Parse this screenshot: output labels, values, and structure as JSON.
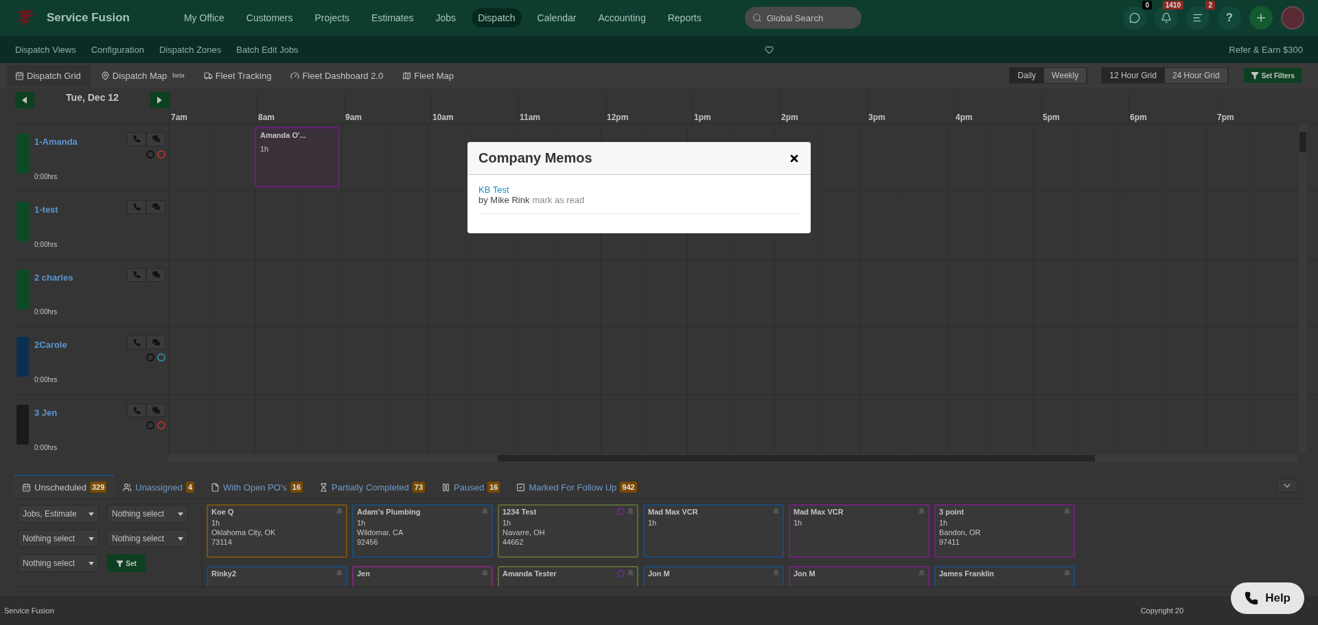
{
  "brand": "Service Fusion",
  "nav": [
    {
      "label": "My Office",
      "selected": false
    },
    {
      "label": "Customers",
      "selected": false
    },
    {
      "label": "Projects",
      "selected": false
    },
    {
      "label": "Estimates",
      "selected": false
    },
    {
      "label": "Jobs",
      "selected": false
    },
    {
      "label": "Dispatch",
      "selected": true
    },
    {
      "label": "Calendar",
      "selected": false
    },
    {
      "label": "Accounting",
      "selected": false
    },
    {
      "label": "Reports",
      "selected": false
    }
  ],
  "search": {
    "placeholder": "Global Search"
  },
  "header_buttons": [
    {
      "kind": "chat",
      "badge": "0",
      "color": "#000000"
    },
    {
      "kind": "bell",
      "badge": "1410",
      "color": "#8a2a22"
    },
    {
      "kind": "list",
      "badge": "2",
      "color": "#8a2a22"
    },
    {
      "kind": "help",
      "label": "?"
    },
    {
      "kind": "add"
    },
    {
      "kind": "avatar"
    }
  ],
  "subnav": [
    "Dispatch Views",
    "Configuration",
    "Dispatch Zones",
    "Batch Edit Jobs"
  ],
  "refer": "Refer & Earn $300",
  "view_tabs": [
    {
      "kind": "grid",
      "label": "Dispatch Grid",
      "selected": true
    },
    {
      "kind": "map",
      "label": "Dispatch Map",
      "sup": "beta",
      "selected": false
    },
    {
      "kind": "truck",
      "label": "Fleet Tracking",
      "selected": false
    },
    {
      "kind": "gauge",
      "label": "Fleet Dashboard 2.0",
      "selected": false
    },
    {
      "kind": "fleetmap",
      "label": "Fleet Map",
      "selected": false
    }
  ],
  "period": [
    {
      "label": "Daily",
      "selected": true
    },
    {
      "label": "Weekly",
      "selected": false
    }
  ],
  "grid_mode": [
    {
      "label": "12 Hour Grid",
      "selected": true
    },
    {
      "label": "24 Hour Grid",
      "selected": false
    }
  ],
  "set_filters": "Set Filters",
  "date": "Tue, Dec 12",
  "hours": [
    "7am",
    "8am",
    "9am",
    "10am",
    "11am",
    "12pm",
    "1pm",
    "2pm",
    "3pm",
    "4pm",
    "5pm",
    "6pm",
    "7pm"
  ],
  "technicians": [
    {
      "name": "1-Amanda",
      "hours": "0:00hrs",
      "color": "#0b4a26",
      "rings": [
        {
          "color": "#111111"
        },
        {
          "color": "#a83232"
        }
      ],
      "jobs": [
        {
          "title": "Amanda O'...",
          "duration": "1h",
          "color": "#6a1f7a"
        }
      ]
    },
    {
      "name": "1-test",
      "hours": "0:00hrs",
      "color": "#0b4a26"
    },
    {
      "name": "2 charles",
      "hours": "0:00hrs",
      "color": "#0b4a26"
    },
    {
      "name": "2Carole",
      "hours": "0:00hrs",
      "color": "#0b2f52",
      "rings": [
        {
          "color": "#111111"
        },
        {
          "color": "#2a8a98"
        }
      ]
    },
    {
      "name": "3 Jen",
      "hours": "0:00hrs",
      "color": "#1a1a1a",
      "rings": [
        {
          "color": "#111111"
        },
        {
          "color": "#a83232"
        }
      ]
    }
  ],
  "bottom_tabs": [
    {
      "kind": "grid",
      "label": "Unscheduled",
      "count": "329",
      "selected": true
    },
    {
      "kind": "users",
      "label": "Unassigned",
      "count": "4",
      "selected": false
    },
    {
      "kind": "file",
      "label": "With Open PO's",
      "count": "16",
      "selected": false
    },
    {
      "kind": "hourglass",
      "label": "Partially Completed",
      "count": "73",
      "selected": false
    },
    {
      "kind": "pause",
      "label": "Paused",
      "count": "16",
      "selected": false
    },
    {
      "kind": "check",
      "label": "Marked For Follow Up",
      "count": "942",
      "selected": false
    }
  ],
  "filters": [
    "Jobs, Estimate",
    "Nothing select",
    "Nothing select",
    "Nothing select",
    "Nothing select"
  ],
  "set_button": "Set",
  "cards": [
    {
      "name": "Koe Q",
      "lines": [
        "1h",
        "Oklahoma City, OK",
        "73114"
      ],
      "color": "#7a5212"
    },
    {
      "name": "Adam's Plumbing",
      "lines": [
        "1h",
        "Wildomar, CA",
        "92456"
      ],
      "color": "#1c4a78"
    },
    {
      "name": "1234 Test",
      "lines": [
        "1h",
        "Navarre, OH",
        "44662"
      ],
      "color": "#5a6a34",
      "status": {
        "color": "#6a2a8a"
      }
    },
    {
      "name": "Mad Max VCR",
      "lines": [
        "1h"
      ],
      "color": "#1c4a78"
    },
    {
      "name": "Mad Max VCR",
      "lines": [
        "1h"
      ],
      "color": "#6e2478"
    },
    {
      "name": "3 point",
      "lines": [
        "1h",
        "Bandon, OR",
        "97411"
      ],
      "color": "#6e2478"
    },
    {
      "name": "Rinky2",
      "color": "#1c4a78"
    },
    {
      "name": "Jen",
      "color": "#7a2a7a"
    },
    {
      "name": "Amanda Tester",
      "color": "#5a6a34",
      "status": {
        "color": "#6a2a8a"
      }
    },
    {
      "name": "Jon M",
      "color": "#1c4a78"
    },
    {
      "name": "Jon M",
      "color": "#6e2478"
    },
    {
      "name": "James Franklin",
      "color": "#1c4a78"
    }
  ],
  "footer": {
    "left": "Service Fusion",
    "right": "Copyright 20"
  },
  "help": "Help",
  "modal": {
    "title": "Company Memos",
    "memos": [
      {
        "title": "KB Test",
        "author": "by Mike Rink",
        "action": "mark as read"
      }
    ]
  }
}
